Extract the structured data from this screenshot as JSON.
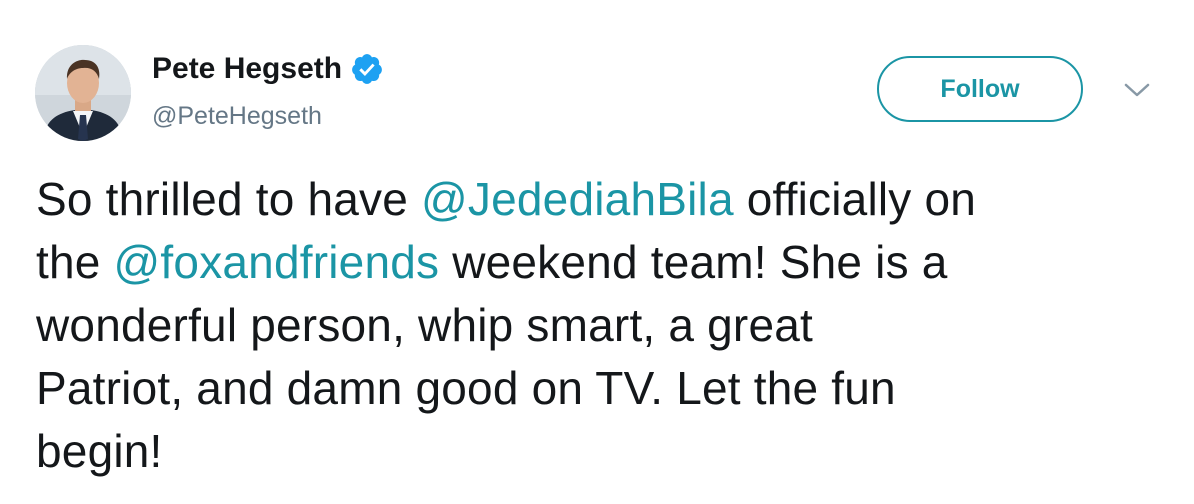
{
  "author": {
    "display_name": "Pete Hegseth",
    "handle": "@PeteHegseth",
    "verified": true
  },
  "actions": {
    "follow_label": "Follow"
  },
  "tweet": {
    "line1_a": "So thrilled to have ",
    "mention1": "@JedediahBila",
    "line1_b": " officially on",
    "line2_a": "the ",
    "mention2": "@foxandfriends",
    "line2_b": " weekend team! She is a",
    "line3": "wonderful person, whip smart, a great",
    "line4": "Patriot, and damn good on TV. Let the fun",
    "line5": "begin!"
  },
  "colors": {
    "accent": "#1b95a5",
    "verified_badge": "#1da1f2",
    "text": "#14171a",
    "secondary_text": "#657786"
  },
  "icons": {
    "verified": "verified-badge-icon",
    "more": "chevron-down-icon"
  }
}
